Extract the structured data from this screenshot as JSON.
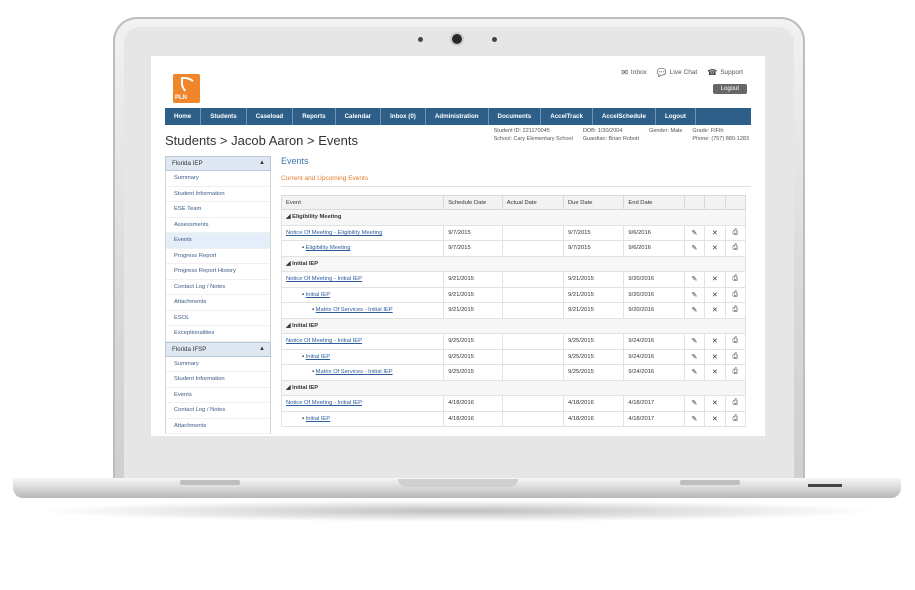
{
  "toplinks": [
    {
      "icon": "envelope-icon",
      "label": "Inbox"
    },
    {
      "icon": "chat-icon",
      "label": "Live Chat"
    },
    {
      "icon": "phone-icon",
      "label": "Support"
    }
  ],
  "logout_label": "Logout",
  "logo_text": "PLN",
  "nav": [
    "Home",
    "Students",
    "Caseload",
    "Reports",
    "Calendar",
    "Inbox (0)",
    "Administration",
    "Documents",
    "AccelTrack",
    "AccelSchedule",
    "Logout"
  ],
  "page_title": "Students > Jacob Aaron > Events",
  "student_info": {
    "id": "Student ID: 221170045",
    "school": "School: Cary Elementary School",
    "dob": "DOB: 1/30/2004",
    "guardian": "Guardian: Brian Robott",
    "gender": "Gender: Male",
    "grade": "Grade: FIFth",
    "phone": "Phone: (757) 880-1283"
  },
  "sidebar": {
    "section1": "Florida IEP",
    "items1": [
      "Summary",
      "Student Information",
      "ESE Team",
      "Assessments",
      "Events",
      "Progress Report",
      "Progress Report History",
      "Contact Log / Notes",
      "Attachments",
      "ESOL",
      "Exceptionalities"
    ],
    "section2": "Florida IFSP",
    "items2": [
      "Summary",
      "Student Information",
      "Events",
      "Contact Log / Notes",
      "Attachments"
    ]
  },
  "main": {
    "heading": "Events",
    "subheading": "Current and Upcoming Events",
    "columns": [
      "Event",
      "Schedule Date",
      "Actual Date",
      "Due Date",
      "End Date"
    ],
    "groups": [
      {
        "name": "Eligibility Meeting",
        "rows": [
          {
            "event": "Notice Of Meeting - Eligibility Meeting",
            "indent": 0,
            "schedule": "9/7/2015",
            "actual": "",
            "due": "9/7/2015",
            "end": "9/6/2016"
          },
          {
            "event": "Eligibility Meeting",
            "indent": 1,
            "schedule": "9/7/2015",
            "actual": "",
            "due": "9/7/2015",
            "end": "9/6/2016"
          }
        ]
      },
      {
        "name": "Initial IEP",
        "rows": [
          {
            "event": "Notice Of Meeting - Initial IEP",
            "indent": 0,
            "schedule": "9/21/2015",
            "actual": "",
            "due": "9/21/2015",
            "end": "9/20/2016"
          },
          {
            "event": "Initial IEP",
            "indent": 1,
            "schedule": "9/21/2015",
            "actual": "",
            "due": "9/21/2015",
            "end": "9/20/2016"
          },
          {
            "event": "Matrix Of Services - Initial IEP",
            "indent": 2,
            "schedule": "9/21/2015",
            "actual": "",
            "due": "9/21/2015",
            "end": "9/20/2016"
          }
        ]
      },
      {
        "name": "Initial IEP",
        "rows": [
          {
            "event": "Notice Of Meeting - Initial IEP",
            "indent": 0,
            "schedule": "9/25/2015",
            "actual": "",
            "due": "9/25/2015",
            "end": "9/24/2016"
          },
          {
            "event": "Initial IEP",
            "indent": 1,
            "schedule": "9/25/2015",
            "actual": "",
            "due": "9/25/2015",
            "end": "9/24/2016"
          },
          {
            "event": "Matrix Of Services - Initial IEP",
            "indent": 2,
            "schedule": "9/25/2015",
            "actual": "",
            "due": "9/25/2015",
            "end": "9/24/2016"
          }
        ]
      },
      {
        "name": "Initial IEP",
        "rows": [
          {
            "event": "Notice Of Meeting - Initial IEP",
            "indent": 0,
            "schedule": "4/18/2016",
            "actual": "",
            "due": "4/18/2016",
            "end": "4/18/2017"
          },
          {
            "event": "Initial IEP",
            "indent": 1,
            "schedule": "4/18/2016",
            "actual": "",
            "due": "4/18/2016",
            "end": "4/18/2017"
          }
        ]
      }
    ]
  }
}
